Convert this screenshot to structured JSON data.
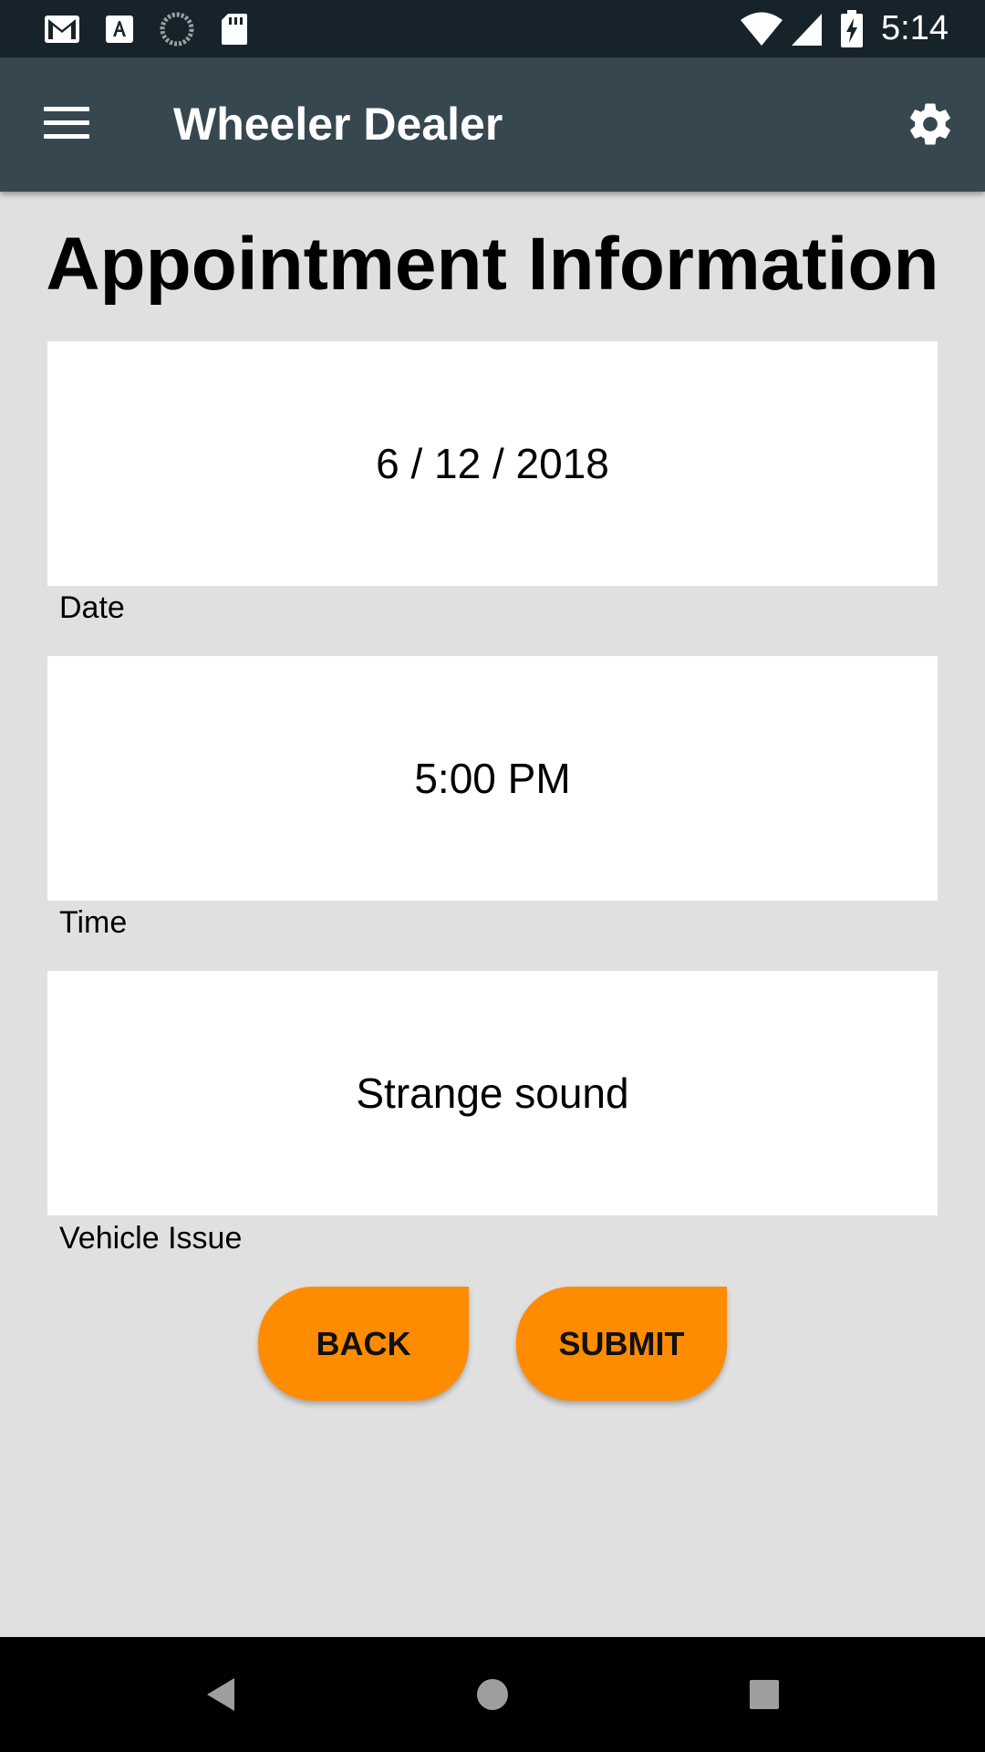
{
  "status_bar": {
    "time": "5:14",
    "icons": [
      "gmail-icon",
      "font-app-icon",
      "sync-icon",
      "sd-card-icon",
      "wifi-icon",
      "signal-icon",
      "battery-charging-icon"
    ]
  },
  "app_bar": {
    "title": "Wheeler Dealer",
    "menu_icon": "hamburger-menu-icon",
    "settings_icon": "gear-icon"
  },
  "main": {
    "title": "Appointment Information",
    "fields": [
      {
        "value": "6 / 12 / 2018",
        "label": "Date"
      },
      {
        "value": "5:00 PM",
        "label": "Time"
      },
      {
        "value": "Strange sound",
        "label": "Vehicle Issue"
      }
    ],
    "buttons": {
      "back_label": "BACK",
      "submit_label": "SUBMIT"
    }
  },
  "nav_bar": {
    "icons": [
      "back-triangle-icon",
      "home-circle-icon",
      "recents-square-icon"
    ]
  },
  "colors": {
    "status_bar": "#17232a",
    "app_bar": "#37474f",
    "background": "#e0e0e0",
    "accent": "#ff8c00"
  }
}
